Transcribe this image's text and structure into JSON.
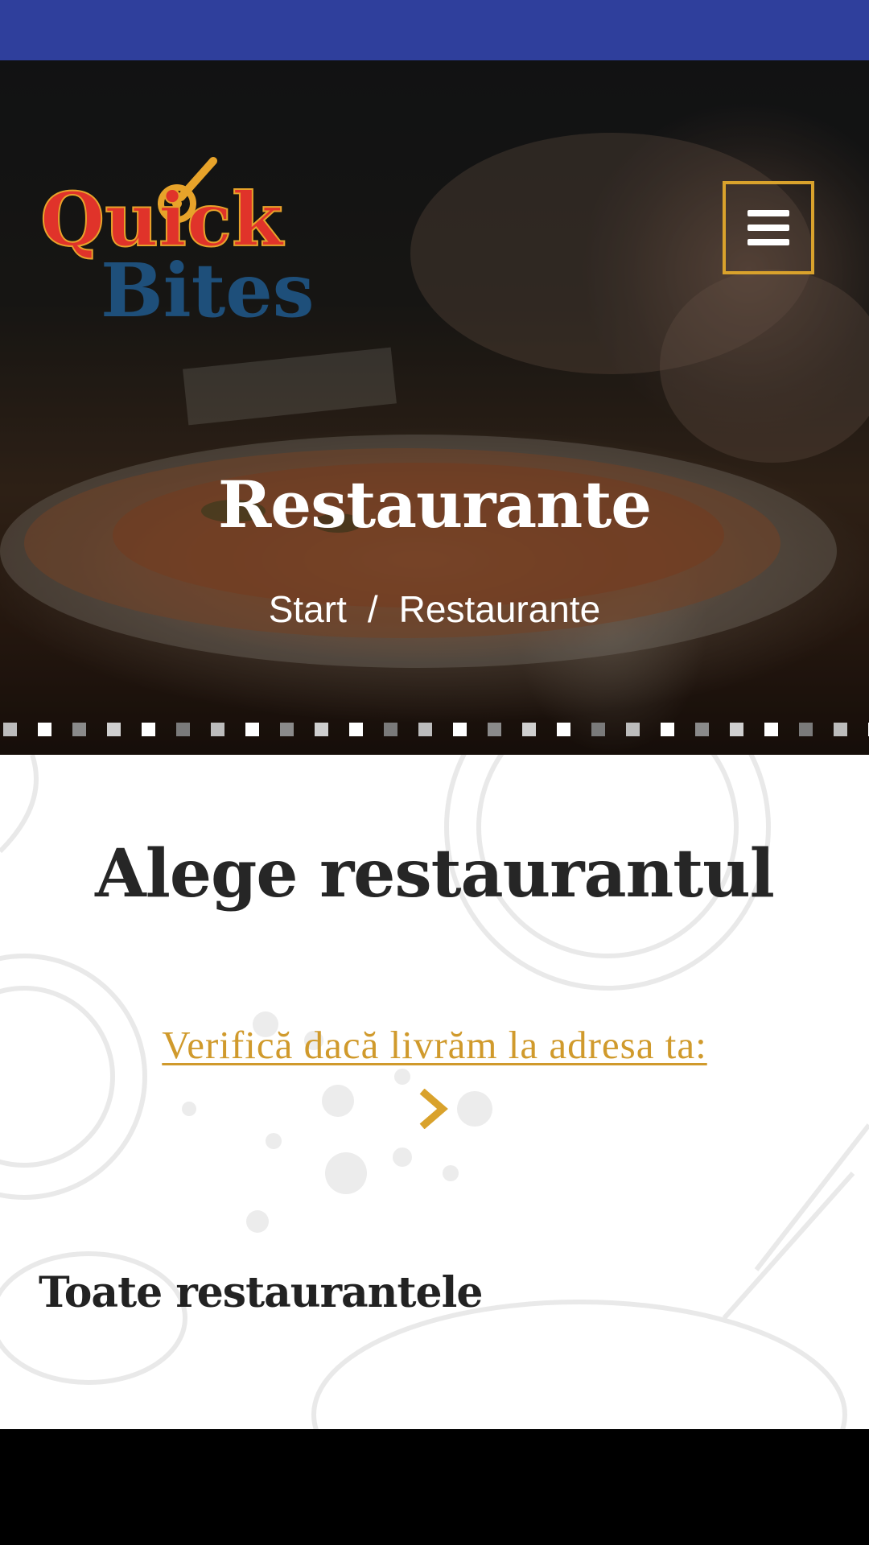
{
  "colors": {
    "status_bar": "#2f3f9c",
    "accent_gold": "#d9a22c",
    "link_gold": "#d09a2c",
    "logo_red": "#e0332a",
    "logo_blue": "#1e4f7a",
    "heading_dark": "#262626"
  },
  "header": {
    "logo": {
      "line1": "Quick",
      "line2": "Bites",
      "icon": "pizza-cutter-icon"
    },
    "menu_icon": "hamburger-icon"
  },
  "hero": {
    "title": "Restaurante",
    "breadcrumb": {
      "home": "Start",
      "separator": "/",
      "current": "Restaurante"
    }
  },
  "main": {
    "section_title": "Alege restaurantul",
    "address_link": "Verifică dacă livrăm la adresa ta:",
    "address_arrow_icon": "chevron-right-icon",
    "all_restaurants_title": "Toate restaurantele"
  }
}
